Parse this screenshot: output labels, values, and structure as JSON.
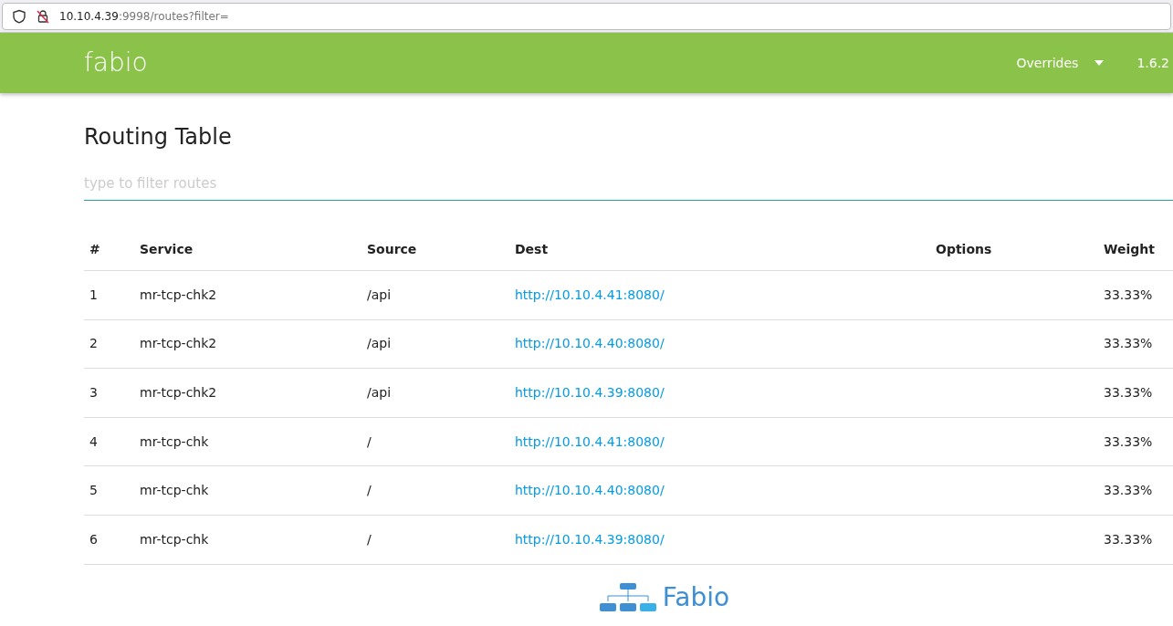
{
  "browser": {
    "url_host": "10.10.4.39",
    "url_rest": ":9998/routes?filter="
  },
  "navbar": {
    "brand": "fabio",
    "menu": "Overrides",
    "version": "1.6.2"
  },
  "page": {
    "title": "Routing Table",
    "filter": {
      "placeholder": "type to filter routes"
    }
  },
  "table": {
    "columns": [
      "#",
      "Service",
      "Source",
      "Dest",
      "Options",
      "Weight"
    ],
    "rows": [
      {
        "n": "1",
        "service": "mr-tcp-chk2",
        "source": "/api",
        "dest": "http://10.10.4.41:8080/",
        "options": "",
        "weight": "33.33%"
      },
      {
        "n": "2",
        "service": "mr-tcp-chk2",
        "source": "/api",
        "dest": "http://10.10.4.40:8080/",
        "options": "",
        "weight": "33.33%"
      },
      {
        "n": "3",
        "service": "mr-tcp-chk2",
        "source": "/api",
        "dest": "http://10.10.4.39:8080/",
        "options": "",
        "weight": "33.33%"
      },
      {
        "n": "4",
        "service": "mr-tcp-chk",
        "source": "/",
        "dest": "http://10.10.4.41:8080/",
        "options": "",
        "weight": "33.33%"
      },
      {
        "n": "5",
        "service": "mr-tcp-chk",
        "source": "/",
        "dest": "http://10.10.4.40:8080/",
        "options": "",
        "weight": "33.33%"
      },
      {
        "n": "6",
        "service": "mr-tcp-chk",
        "source": "/",
        "dest": "http://10.10.4.39:8080/",
        "options": "",
        "weight": "33.33%"
      }
    ]
  },
  "footer": {
    "logo_text": "Fabio"
  }
}
